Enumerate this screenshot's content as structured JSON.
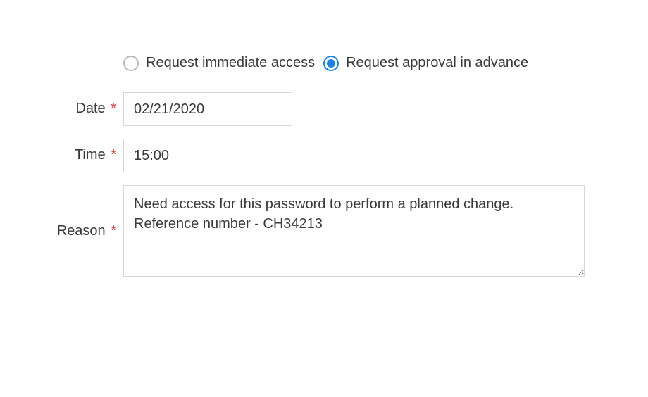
{
  "access_type": {
    "options": [
      {
        "label": "Request immediate access",
        "selected": false
      },
      {
        "label": "Request approval in advance",
        "selected": true
      }
    ]
  },
  "fields": {
    "date": {
      "label": "Date",
      "required_mark": "*",
      "value": "02/21/2020"
    },
    "time": {
      "label": "Time",
      "required_mark": "*",
      "value": "15:00"
    },
    "reason": {
      "label": "Reason",
      "required_mark": "*",
      "value": "Need access for this password to perform a planned change. Reference number - CH34213"
    }
  }
}
